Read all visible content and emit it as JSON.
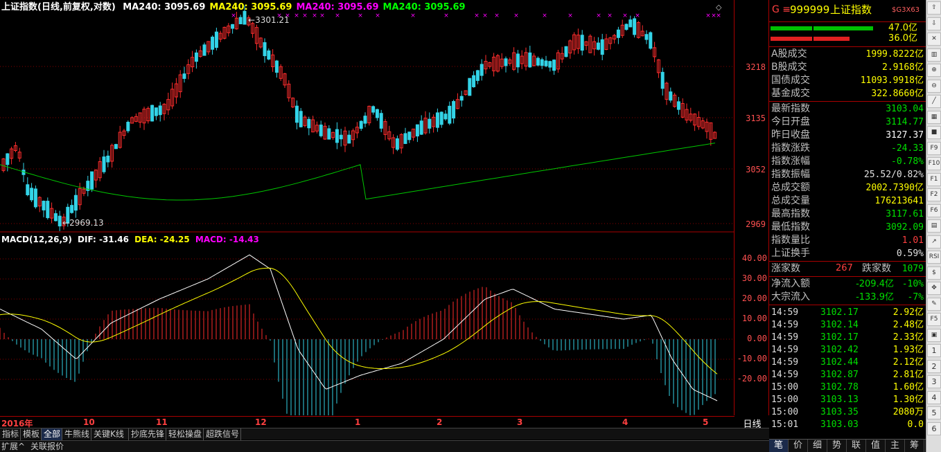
{
  "header": {
    "title": "上证指数(日线,前复权,对数)",
    "ma": [
      {
        "label": "MA240: 3095.69",
        "color": "#ffffff"
      },
      {
        "label": "MA240: 3095.69",
        "color": "#ffff00"
      },
      {
        "label": "MA240: 3095.69",
        "color": "#ff00ff"
      },
      {
        "label": "MA240: 3095.69",
        "color": "#00ff00"
      }
    ]
  },
  "macd_header": {
    "name": "MACD(12,26,9)",
    "dif": "DIF: -31.46",
    "dea": "DEA: -24.25",
    "macd": "MACD: -14.43"
  },
  "annotations": {
    "high": "3301.21",
    "low": "2969.13"
  },
  "price_axis": [
    "3218",
    "3135",
    "3052",
    "2969"
  ],
  "macd_axis": [
    "40.00",
    "30.00",
    "20.00",
    "10.00",
    "0.00",
    "-10.00",
    "-20.00"
  ],
  "x_axis": {
    "year": "2016年",
    "months": [
      "10",
      "11",
      "12",
      "1",
      "2",
      "3",
      "4",
      "5"
    ]
  },
  "period": "日线",
  "period_controls": [
    "+",
    "-",
    "○"
  ],
  "tabs": [
    "指标",
    "模板",
    "全部",
    "牛熊线",
    "关键K线",
    "抄底先锋",
    "轻松操盘",
    "超跌信号"
  ],
  "active_tab": "全部",
  "bottom_links": [
    "扩展^",
    "关联报价"
  ],
  "panel": {
    "code_prefix": "G ≡",
    "code": "999999",
    "name": "上证指数",
    "tag": "$G3X63",
    "bars": [
      {
        "value": "47.0亿",
        "color": "#00c000"
      },
      {
        "value": "36.0亿",
        "color": "#e02020"
      }
    ],
    "volume_rows": [
      {
        "label": "A股成交",
        "value": "1999.8222亿"
      },
      {
        "label": "B股成交",
        "value": "2.9168亿"
      },
      {
        "label": "国债成交",
        "value": "11093.9918亿"
      },
      {
        "label": "基金成交",
        "value": "322.8660亿"
      }
    ],
    "stats": [
      {
        "label": "最新指数",
        "value": "3103.04",
        "color": "#00e000"
      },
      {
        "label": "今日开盘",
        "value": "3114.77",
        "color": "#00e000"
      },
      {
        "label": "昨日收盘",
        "value": "3127.37",
        "color": "#ffffff"
      },
      {
        "label": "指数涨跌",
        "value": "-24.33",
        "color": "#00e000"
      },
      {
        "label": "指数涨幅",
        "value": "-0.78%",
        "color": "#00e000"
      },
      {
        "label": "指数振幅",
        "value": "25.52/0.82%",
        "color": "#e0e0e0"
      },
      {
        "label": "总成交额",
        "value": "2002.7390亿",
        "color": "#ffff00"
      },
      {
        "label": "总成交量",
        "value": "176213641",
        "color": "#ffff00"
      },
      {
        "label": "最高指数",
        "value": "3117.61",
        "color": "#00e000"
      },
      {
        "label": "最低指数",
        "value": "3092.09",
        "color": "#00e000"
      },
      {
        "label": "指数量比",
        "value": "1.01",
        "color": "#ff4040"
      },
      {
        "label": "上证换手",
        "value": "0.59%",
        "color": "#e0e0e0"
      }
    ],
    "breadth": {
      "up_label": "涨家数",
      "up": "267",
      "down_label": "跌家数",
      "down": "1079"
    },
    "flows": [
      {
        "label": "净流入额",
        "value": "-209.4亿",
        "pct": "-10%"
      },
      {
        "label": "大宗流入",
        "value": "-133.9亿",
        "pct": "-7%"
      }
    ],
    "ticks": [
      {
        "time": "14:59",
        "price": "3102.17",
        "vol": "2.92亿"
      },
      {
        "time": "14:59",
        "price": "3102.14",
        "vol": "2.48亿"
      },
      {
        "time": "14:59",
        "price": "3102.17",
        "vol": "2.33亿"
      },
      {
        "time": "14:59",
        "price": "3102.42",
        "vol": "1.93亿"
      },
      {
        "time": "14:59",
        "price": "3102.44",
        "vol": "2.12亿"
      },
      {
        "time": "14:59",
        "price": "3102.87",
        "vol": "2.81亿"
      },
      {
        "time": "15:00",
        "price": "3102.78",
        "vol": "1.60亿"
      },
      {
        "time": "15:00",
        "price": "3103.13",
        "vol": "1.30亿"
      },
      {
        "time": "15:00",
        "price": "3103.35",
        "vol": "2080万"
      },
      {
        "time": "15:01",
        "price": "3103.03",
        "vol": "0.0"
      }
    ],
    "bottom_tabs": [
      "笔",
      "价",
      "细",
      "势",
      "联",
      "值",
      "主",
      "筹"
    ]
  },
  "toolbar": [
    "up-arrow-icon",
    "down-arrow-icon",
    "close-icon",
    "candle-icon",
    "zoom-in-icon",
    "zoom-out-icon",
    "line-icon",
    "bar-icon",
    "color-icon",
    "f9-icon",
    "f10-icon",
    "f1-icon",
    "f2-icon",
    "f6-icon",
    "chart-icon",
    "trend-icon",
    "rsi-icon",
    "dollar-icon",
    "move-icon",
    "pen-icon",
    "f5-icon",
    "page-icon",
    "1",
    "2",
    "3",
    "4",
    "5",
    "6"
  ],
  "colors": {
    "up": "#ff2d2d",
    "down": "#33d4e8",
    "ma": "#00c800",
    "dif": "#ffffff",
    "dea": "#ffff00",
    "grid": "#8a0000"
  }
}
